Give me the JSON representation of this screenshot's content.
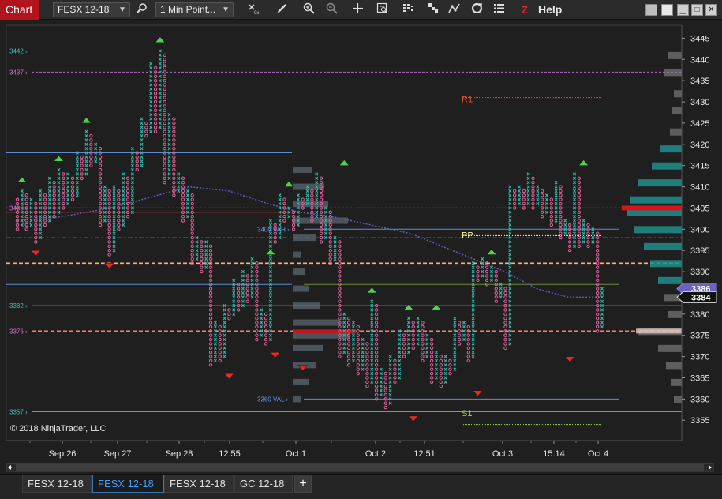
{
  "toolbar": {
    "title": "Chart",
    "instrument": "FESX 12-18",
    "interval": "1 Min Point...",
    "help": "Help",
    "icons": [
      "magnifier-icon",
      "crosshair-data-icon",
      "pencil-icon",
      "zoom-in-icon",
      "zoom-out-icon",
      "cross-icon",
      "data-box-icon",
      "bar-style-icon",
      "order-flow-icon",
      "indicators-icon",
      "strategies-icon",
      "properties-icon",
      "z-icon"
    ]
  },
  "copyright": "© 2018 NinjaTrader, LLC",
  "colors": {
    "background": "#1f1f1f",
    "up": "#2fb7a8",
    "down": "#e0609a",
    "accent": "#b3141b",
    "profile": "#1e8f8f",
    "poc": "#d6151b"
  },
  "chart_data": {
    "type": "point-and-figure",
    "ylim": [
      3353,
      3446
    ],
    "y_ticks": [
      3445,
      3440,
      3435,
      3430,
      3425,
      3420,
      3415,
      3410,
      3405,
      3400,
      3395,
      3390,
      3385,
      3380,
      3375,
      3370,
      3365,
      3360,
      3355
    ],
    "x_ticks": [
      "Sep 26",
      "Sep 27",
      "Sep 28",
      "12:55",
      "Oct 1",
      "Oct 2",
      "12:51",
      "Oct 3",
      "15:14",
      "Oct 4"
    ],
    "price_markers": [
      {
        "label": "3386",
        "price": 3386
      },
      {
        "label": "3384",
        "price": 3384
      }
    ],
    "left_levels": [
      "3442",
      "3437",
      "3405",
      "3382",
      "3376",
      "3357"
    ],
    "level_labels": [
      {
        "label": "3400 VAH",
        "price": 3400
      },
      {
        "label": "3360 VAL",
        "price": 3360
      },
      {
        "label": "R1",
        "price": 3429
      },
      {
        "label": "PP",
        "price": 3397
      },
      {
        "label": "S1",
        "price": 3355
      }
    ],
    "columns": [
      {
        "t": "o",
        "lo": 3400,
        "hi": 3407
      },
      {
        "t": "x",
        "lo": 3401,
        "hi": 3409
      },
      {
        "t": "o",
        "lo": 3400,
        "hi": 3408
      },
      {
        "t": "x",
        "lo": 3401,
        "hi": 3407
      },
      {
        "t": "o",
        "lo": 3397,
        "hi": 3406
      },
      {
        "t": "x",
        "lo": 3398,
        "hi": 3409
      },
      {
        "t": "o",
        "lo": 3401,
        "hi": 3408
      },
      {
        "t": "x",
        "lo": 3402,
        "hi": 3412
      },
      {
        "t": "o",
        "lo": 3403,
        "hi": 3411
      },
      {
        "t": "x",
        "lo": 3404,
        "hi": 3414
      },
      {
        "t": "o",
        "lo": 3405,
        "hi": 3413
      },
      {
        "t": "x",
        "lo": 3406,
        "hi": 3413
      },
      {
        "t": "o",
        "lo": 3407,
        "hi": 3412
      },
      {
        "t": "x",
        "lo": 3408,
        "hi": 3418
      },
      {
        "t": "o",
        "lo": 3412,
        "hi": 3417
      },
      {
        "t": "x",
        "lo": 3413,
        "hi": 3423
      },
      {
        "t": "o",
        "lo": 3415,
        "hi": 3422
      },
      {
        "t": "x",
        "lo": 3416,
        "hi": 3420
      },
      {
        "t": "o",
        "lo": 3401,
        "hi": 3419
      },
      {
        "t": "x",
        "lo": 3402,
        "hi": 3410
      },
      {
        "t": "o",
        "lo": 3394,
        "hi": 3409
      },
      {
        "t": "x",
        "lo": 3395,
        "hi": 3410
      },
      {
        "t": "o",
        "lo": 3400,
        "hi": 3409
      },
      {
        "t": "x",
        "lo": 3401,
        "hi": 3413
      },
      {
        "t": "o",
        "lo": 3403,
        "hi": 3412
      },
      {
        "t": "x",
        "lo": 3404,
        "hi": 3419
      },
      {
        "t": "o",
        "lo": 3414,
        "hi": 3418
      },
      {
        "t": "x",
        "lo": 3415,
        "hi": 3426
      },
      {
        "t": "o",
        "lo": 3422,
        "hi": 3425
      },
      {
        "t": "x",
        "lo": 3423,
        "hi": 3439
      },
      {
        "t": "o",
        "lo": 3423,
        "hi": 3438
      },
      {
        "t": "x",
        "lo": 3424,
        "hi": 3442
      },
      {
        "t": "o",
        "lo": 3411,
        "hi": 3441
      },
      {
        "t": "x",
        "lo": 3412,
        "hi": 3427
      },
      {
        "t": "o",
        "lo": 3408,
        "hi": 3426
      },
      {
        "t": "x",
        "lo": 3409,
        "hi": 3413
      },
      {
        "t": "o",
        "lo": 3402,
        "hi": 3412
      },
      {
        "t": "x",
        "lo": 3403,
        "hi": 3409
      },
      {
        "t": "o",
        "lo": 3392,
        "hi": 3408
      },
      {
        "t": "x",
        "lo": 3393,
        "hi": 3398
      },
      {
        "t": "o",
        "lo": 3390,
        "hi": 3397
      },
      {
        "t": "x",
        "lo": 3391,
        "hi": 3397
      },
      {
        "t": "o",
        "lo": 3368,
        "hi": 3396
      },
      {
        "t": "x",
        "lo": 3369,
        "hi": 3378
      },
      {
        "t": "o",
        "lo": 3369,
        "hi": 3377
      },
      {
        "t": "x",
        "lo": 3370,
        "hi": 3382
      },
      {
        "t": "o",
        "lo": 3379,
        "hi": 3381
      },
      {
        "t": "x",
        "lo": 3380,
        "hi": 3388
      },
      {
        "t": "o",
        "lo": 3381,
        "hi": 3387
      },
      {
        "t": "x",
        "lo": 3382,
        "hi": 3390
      },
      {
        "t": "o",
        "lo": 3383,
        "hi": 3389
      },
      {
        "t": "x",
        "lo": 3384,
        "hi": 3393
      },
      {
        "t": "o",
        "lo": 3374,
        "hi": 3392
      },
      {
        "t": "x",
        "lo": 3375,
        "hi": 3381
      },
      {
        "t": "o",
        "lo": 3373,
        "hi": 3380
      },
      {
        "t": "x",
        "lo": 3374,
        "hi": 3402
      },
      {
        "t": "o",
        "lo": 3397,
        "hi": 3401
      },
      {
        "t": "x",
        "lo": 3398,
        "hi": 3408
      },
      {
        "t": "o",
        "lo": 3402,
        "hi": 3407
      },
      {
        "t": "x",
        "lo": 3403,
        "hi": 3405
      },
      {
        "t": "o",
        "lo": 3400,
        "hi": 3404
      },
      {
        "t": "x",
        "lo": 3401,
        "hi": 3408
      },
      {
        "t": "o",
        "lo": 3405,
        "hi": 3407
      },
      {
        "t": "x",
        "lo": 3406,
        "hi": 3410
      },
      {
        "t": "o",
        "lo": 3402,
        "hi": 3409
      },
      {
        "t": "x",
        "lo": 3403,
        "hi": 3413
      },
      {
        "t": "o",
        "lo": 3397,
        "hi": 3412
      },
      {
        "t": "x",
        "lo": 3398,
        "hi": 3405
      },
      {
        "t": "o",
        "lo": 3392,
        "hi": 3404
      },
      {
        "t": "x",
        "lo": 3393,
        "hi": 3398
      },
      {
        "t": "o",
        "lo": 3370,
        "hi": 3397
      },
      {
        "t": "x",
        "lo": 3371,
        "hi": 3380
      },
      {
        "t": "o",
        "lo": 3368,
        "hi": 3379
      },
      {
        "t": "x",
        "lo": 3369,
        "hi": 3378
      },
      {
        "t": "o",
        "lo": 3366,
        "hi": 3377
      },
      {
        "t": "x",
        "lo": 3367,
        "hi": 3374
      },
      {
        "t": "o",
        "lo": 3363,
        "hi": 3373
      },
      {
        "t": "x",
        "lo": 3364,
        "hi": 3383
      },
      {
        "t": "o",
        "lo": 3360,
        "hi": 3382
      },
      {
        "t": "x",
        "lo": 3361,
        "hi": 3367
      },
      {
        "t": "o",
        "lo": 3358,
        "hi": 3366
      },
      {
        "t": "x",
        "lo": 3359,
        "hi": 3370
      },
      {
        "t": "o",
        "lo": 3364,
        "hi": 3369
      },
      {
        "t": "x",
        "lo": 3365,
        "hi": 3376
      },
      {
        "t": "o",
        "lo": 3370,
        "hi": 3375
      },
      {
        "t": "x",
        "lo": 3371,
        "hi": 3379
      },
      {
        "t": "o",
        "lo": 3372,
        "hi": 3378
      },
      {
        "t": "x",
        "lo": 3373,
        "hi": 3379
      },
      {
        "t": "o",
        "lo": 3369,
        "hi": 3378
      },
      {
        "t": "x",
        "lo": 3370,
        "hi": 3375
      },
      {
        "t": "o",
        "lo": 3364,
        "hi": 3374
      },
      {
        "t": "x",
        "lo": 3365,
        "hi": 3371
      },
      {
        "t": "o",
        "lo": 3363,
        "hi": 3370
      },
      {
        "t": "x",
        "lo": 3364,
        "hi": 3370
      },
      {
        "t": "o",
        "lo": 3366,
        "hi": 3369
      },
      {
        "t": "x",
        "lo": 3367,
        "hi": 3379
      },
      {
        "t": "o",
        "lo": 3373,
        "hi": 3378
      },
      {
        "t": "x",
        "lo": 3374,
        "hi": 3378
      },
      {
        "t": "o",
        "lo": 3369,
        "hi": 3377
      },
      {
        "t": "x",
        "lo": 3370,
        "hi": 3392
      },
      {
        "t": "o",
        "lo": 3388,
        "hi": 3391
      },
      {
        "t": "x",
        "lo": 3389,
        "hi": 3393
      },
      {
        "t": "o",
        "lo": 3387,
        "hi": 3392
      },
      {
        "t": "x",
        "lo": 3388,
        "hi": 3391
      },
      {
        "t": "o",
        "lo": 3383,
        "hi": 3390
      },
      {
        "t": "x",
        "lo": 3384,
        "hi": 3387
      },
      {
        "t": "o",
        "lo": 3372,
        "hi": 3386
      },
      {
        "t": "x",
        "lo": 3373,
        "hi": 3410
      },
      {
        "t": "o",
        "lo": 3405,
        "hi": 3409
      },
      {
        "t": "x",
        "lo": 3406,
        "hi": 3410
      },
      {
        "t": "o",
        "lo": 3405,
        "hi": 3409
      },
      {
        "t": "x",
        "lo": 3406,
        "hi": 3413
      },
      {
        "t": "o",
        "lo": 3405,
        "hi": 3412
      },
      {
        "t": "x",
        "lo": 3406,
        "hi": 3410
      },
      {
        "t": "o",
        "lo": 3403,
        "hi": 3409
      },
      {
        "t": "x",
        "lo": 3404,
        "hi": 3408
      },
      {
        "t": "o",
        "lo": 3401,
        "hi": 3407
      },
      {
        "t": "x",
        "lo": 3402,
        "hi": 3411
      },
      {
        "t": "o",
        "lo": 3398,
        "hi": 3410
      },
      {
        "t": "x",
        "lo": 3399,
        "hi": 3402
      },
      {
        "t": "o",
        "lo": 3395,
        "hi": 3401
      },
      {
        "t": "x",
        "lo": 3396,
        "hi": 3413
      },
      {
        "t": "o",
        "lo": 3396,
        "hi": 3412
      },
      {
        "t": "x",
        "lo": 3397,
        "hi": 3402
      },
      {
        "t": "o",
        "lo": 3396,
        "hi": 3401
      },
      {
        "t": "x",
        "lo": 3397,
        "hi": 3400
      },
      {
        "t": "o",
        "lo": 3376,
        "hi": 3399
      },
      {
        "t": "x",
        "lo": 3377,
        "hi": 3386
      }
    ]
  },
  "tabs": [
    {
      "label": "FESX 12-18",
      "active": false
    },
    {
      "label": "FESX 12-18",
      "active": true
    },
    {
      "label": "FESX 12-18",
      "active": false
    },
    {
      "label": "GC 12-18",
      "active": false
    }
  ]
}
